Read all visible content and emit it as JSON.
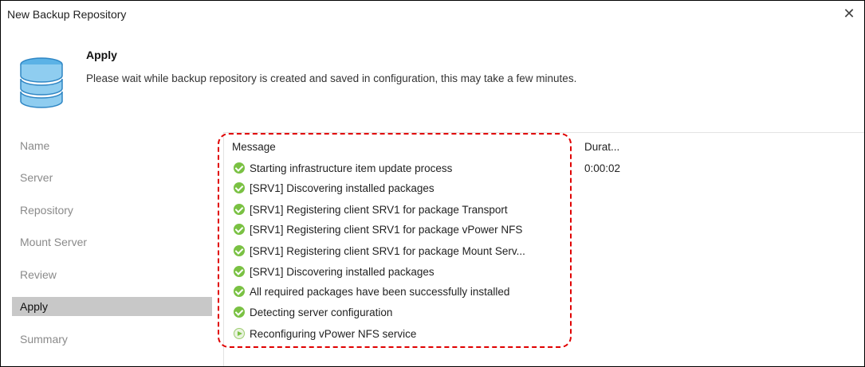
{
  "window": {
    "title": "New Backup Repository",
    "close_label": "✕"
  },
  "header": {
    "icon": "database-icon",
    "title": "Apply",
    "description": "Please wait while backup repository is created and saved in configuration, this may take a few minutes."
  },
  "sidebar": {
    "items": [
      {
        "label": "Name",
        "active": false
      },
      {
        "label": "Server",
        "active": false
      },
      {
        "label": "Repository",
        "active": false
      },
      {
        "label": "Mount Server",
        "active": false
      },
      {
        "label": "Review",
        "active": false
      },
      {
        "label": "Apply",
        "active": true
      },
      {
        "label": "Summary",
        "active": false
      }
    ]
  },
  "log": {
    "columns": {
      "message": "Message",
      "duration": "Durat..."
    },
    "rows": [
      {
        "status": "success",
        "message": "Starting infrastructure item update process",
        "duration": "0:00:02"
      },
      {
        "status": "success",
        "message": "[SRV1] Discovering installed packages",
        "duration": ""
      },
      {
        "status": "success",
        "message": "[SRV1] Registering client SRV1 for package Transport",
        "duration": ""
      },
      {
        "status": "success",
        "message": "[SRV1] Registering client SRV1 for package vPower NFS",
        "duration": ""
      },
      {
        "status": "success",
        "message": "[SRV1] Registering client SRV1 for package Mount Serv...",
        "duration": ""
      },
      {
        "status": "success",
        "message": "[SRV1] Discovering installed packages",
        "duration": ""
      },
      {
        "status": "success",
        "message": "All required packages have been successfully installed",
        "duration": ""
      },
      {
        "status": "success",
        "message": "Detecting server configuration",
        "duration": ""
      },
      {
        "status": "running",
        "message": "Reconfiguring vPower NFS service",
        "duration": ""
      }
    ]
  },
  "colors": {
    "success": "#7ac143",
    "highlight": "#e00000",
    "active_step": "#c8c8c8"
  }
}
